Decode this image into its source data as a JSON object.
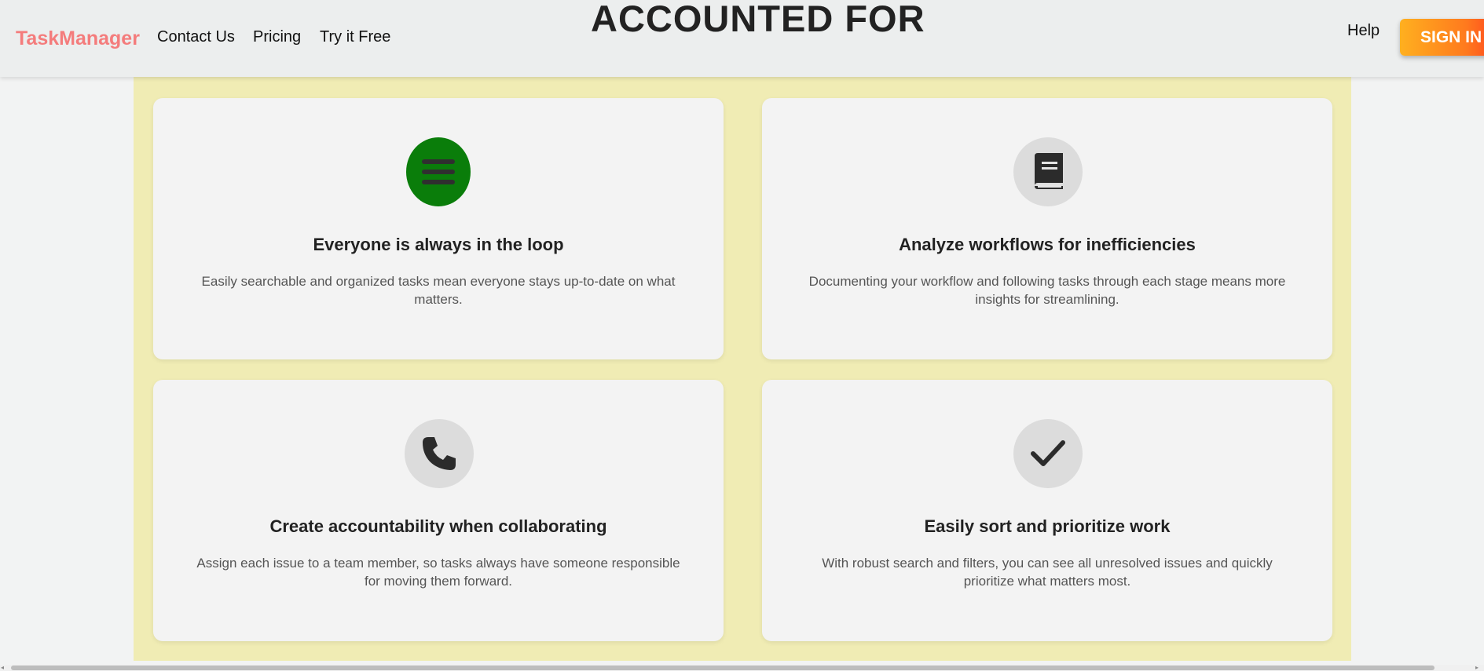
{
  "header": {
    "brand": "TaskManager",
    "nav": [
      "Contact Us",
      "Pricing",
      "Try it Free"
    ],
    "title": "ACCOUNTED FOR",
    "help": "Help",
    "signin": "SIGN IN"
  },
  "features": [
    {
      "icon": "list-icon",
      "title": "Everyone is always in the loop",
      "description": "Easily searchable and organized tasks mean everyone stays up-to-date on what matters."
    },
    {
      "icon": "book-icon",
      "title": "Analyze workflows for inefficiencies",
      "description": "Documenting your workflow and following tasks through each stage means more insights for streamlining."
    },
    {
      "icon": "phone-icon",
      "title": "Create accountability when collaborating",
      "description": "Assign each issue to a team member, so tasks always have someone responsible for moving them forward."
    },
    {
      "icon": "checkmark-icon",
      "title": "Easily sort and prioritize work",
      "description": "With robust search and filters, you can see all unresolved issues and quickly prioritize what matters most."
    }
  ],
  "colors": {
    "brand": "#f47c7c",
    "panel": "#f0ecb4",
    "active_icon": "#0a7d0a",
    "signin_gradient_start": "#ffb01f",
    "signin_gradient_end": "#ff4d1f"
  }
}
